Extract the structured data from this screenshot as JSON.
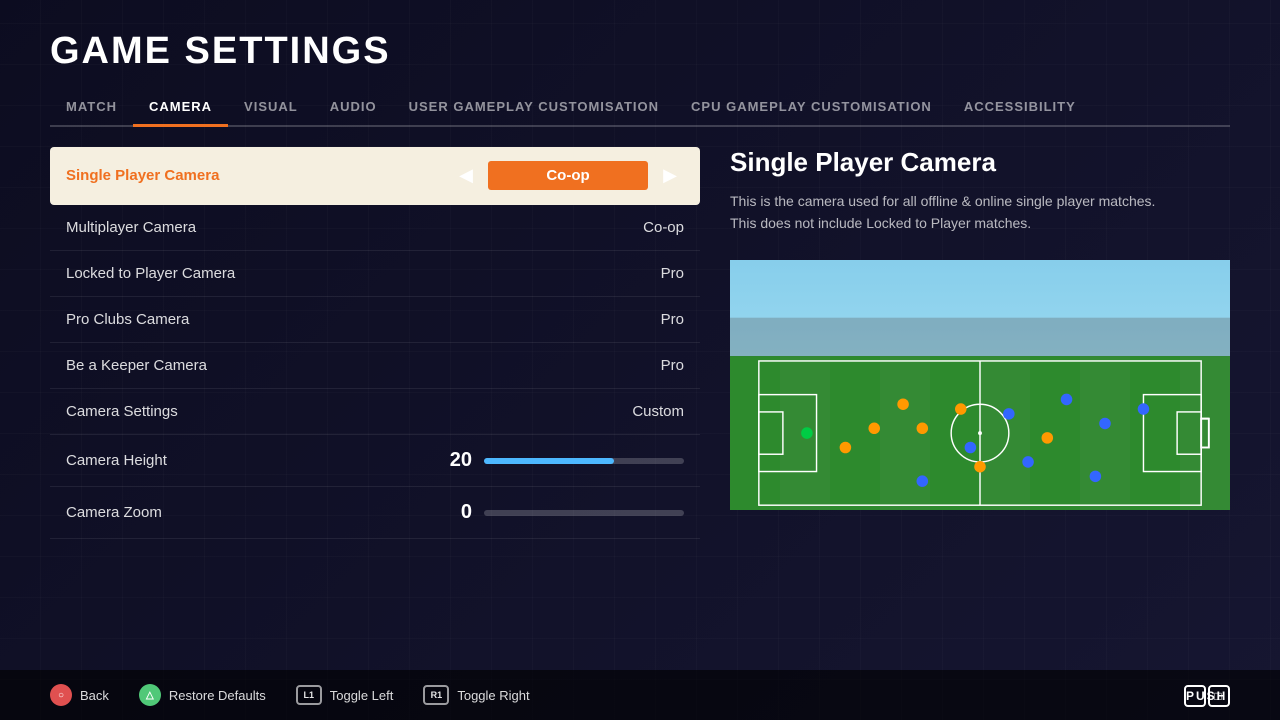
{
  "page": {
    "title": "GAME SETTINGS"
  },
  "tabs": [
    {
      "id": "match",
      "label": "MATCH",
      "active": false
    },
    {
      "id": "camera",
      "label": "CAMERA",
      "active": true
    },
    {
      "id": "visual",
      "label": "VISUAL",
      "active": false
    },
    {
      "id": "audio",
      "label": "AUDIO",
      "active": false
    },
    {
      "id": "user-gameplay",
      "label": "USER GAMEPLAY CUSTOMISATION",
      "active": false
    },
    {
      "id": "cpu-gameplay",
      "label": "CPU GAMEPLAY CUSTOMISATION",
      "active": false
    },
    {
      "id": "accessibility",
      "label": "ACCESSIBILITY",
      "active": false
    }
  ],
  "settings": [
    {
      "id": "single-player-camera",
      "label": "Single Player Camera",
      "value": "Co-op",
      "type": "select",
      "active": true
    },
    {
      "id": "multiplayer-camera",
      "label": "Multiplayer Camera",
      "value": "Co-op",
      "type": "select",
      "active": false
    },
    {
      "id": "locked-to-player-camera",
      "label": "Locked to Player Camera",
      "value": "Pro",
      "type": "select",
      "active": false
    },
    {
      "id": "pro-clubs-camera",
      "label": "Pro Clubs Camera",
      "value": "Pro",
      "type": "select",
      "active": false
    },
    {
      "id": "be-a-keeper-camera",
      "label": "Be a Keeper Camera",
      "value": "Pro",
      "type": "select",
      "active": false
    },
    {
      "id": "camera-settings",
      "label": "Camera Settings",
      "value": "Custom",
      "type": "select",
      "active": false
    }
  ],
  "sliders": [
    {
      "id": "camera-height",
      "label": "Camera Height",
      "value": "20",
      "fill": 65,
      "color": "blue"
    },
    {
      "id": "camera-zoom",
      "label": "Camera Zoom",
      "value": "0",
      "fill": 0,
      "color": "gray"
    }
  ],
  "detail": {
    "title": "Single Player Camera",
    "description": "This is the camera used for all offline & online single player matches.\nThis does not include Locked to Player matches."
  },
  "bottom_actions": [
    {
      "id": "back",
      "label": "Back",
      "btn": "circle",
      "btn_label": "○"
    },
    {
      "id": "restore-defaults",
      "label": "Restore Defaults",
      "btn": "triangle",
      "btn_label": "△"
    },
    {
      "id": "toggle-left",
      "label": "Toggle Left",
      "btn": "l1",
      "btn_label": "L1"
    },
    {
      "id": "toggle-right",
      "label": "Toggle Right",
      "btn": "r1",
      "btn_label": "R1"
    }
  ],
  "brand": {
    "name": "PUSH",
    "icon": "□"
  }
}
